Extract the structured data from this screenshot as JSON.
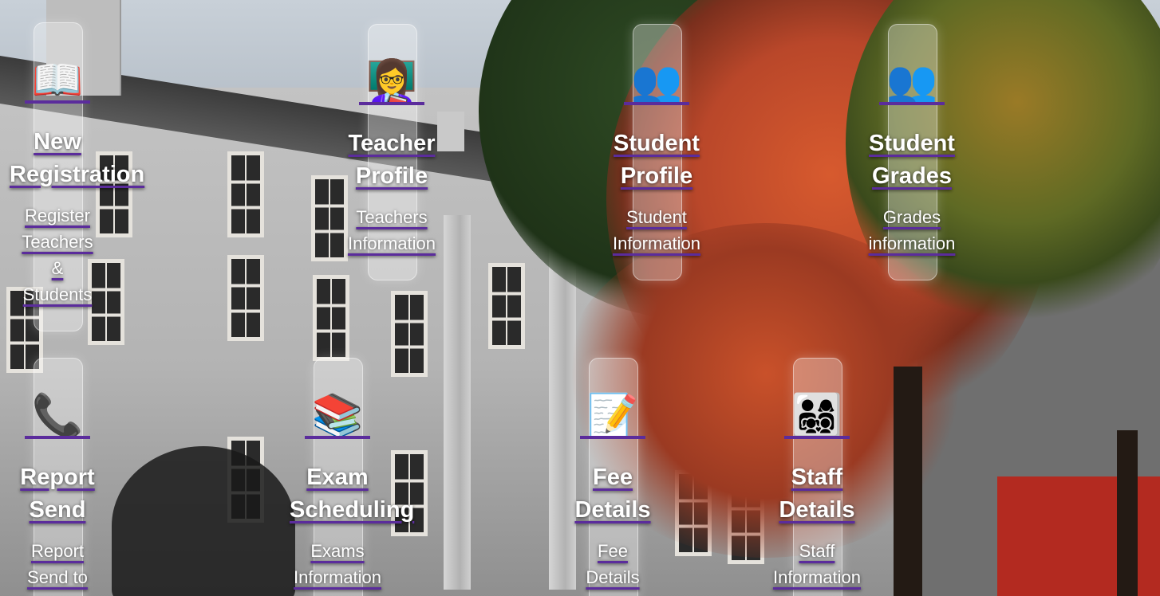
{
  "cards": [
    {
      "icon": "book-icon",
      "glyph": "📖",
      "title": "New\nRegistration",
      "description": "Register\nTeachers\n&\nStudents"
    },
    {
      "icon": "teacher-icon",
      "glyph": "👩‍🏫",
      "title": "Teacher\nProfile",
      "description": "Teachers\nInformation"
    },
    {
      "icon": "students-icon",
      "glyph": "👥",
      "title": "Student\nProfile",
      "description": "Student\nInformation"
    },
    {
      "icon": "students-icon",
      "glyph": "👥",
      "title": "Student\nGrades",
      "description": "Grades\ninformation"
    },
    {
      "icon": "telephone-icon",
      "glyph": "📞",
      "title": "Report\nSend",
      "description": "Report\nSend to"
    },
    {
      "icon": "books-icon",
      "glyph": "📚",
      "title": "Exam\nScheduling",
      "description": "Exams\nInformation"
    },
    {
      "icon": "memo-icon",
      "glyph": "📝",
      "title": "Fee\nDetails",
      "description": "Fee\nDetails"
    },
    {
      "icon": "family-icon",
      "glyph": "👨‍👩‍👧‍👦",
      "title": "Staff\nDetails",
      "description": "Staff\nInformation"
    }
  ],
  "colors": {
    "accent_underline": "#5b2c9c",
    "text": "#ffffff"
  }
}
